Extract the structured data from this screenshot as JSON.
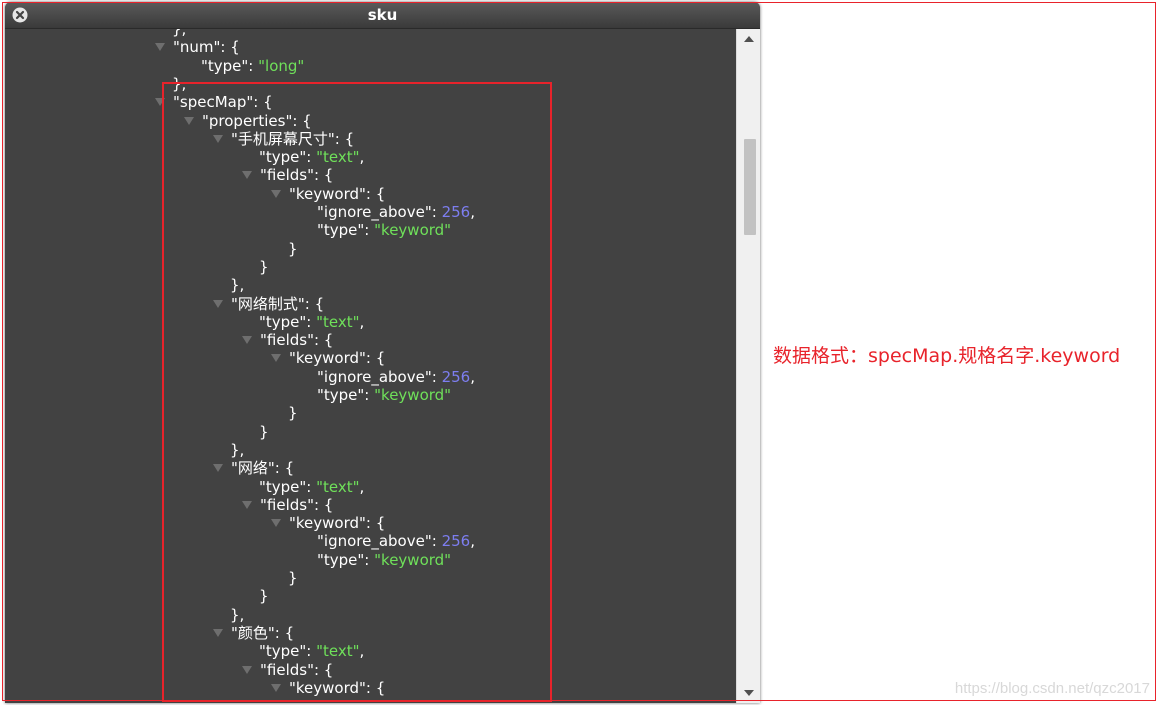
{
  "window": {
    "title": "sku"
  },
  "code_lines": [
    {
      "indent": 8,
      "tri": false,
      "tokens": [
        {
          "t": "},",
          "c": "key"
        }
      ]
    },
    {
      "indent": 8,
      "tri": true,
      "tokens": [
        {
          "t": "\"num\": {",
          "c": "key"
        }
      ]
    },
    {
      "indent": 9,
      "tri": false,
      "tokens": [
        {
          "t": "\"type\": ",
          "c": "key"
        },
        {
          "t": "\"long\"",
          "c": "str"
        }
      ]
    },
    {
      "indent": 8,
      "tri": false,
      "tokens": [
        {
          "t": "},",
          "c": "key"
        }
      ]
    },
    {
      "indent": 8,
      "tri": true,
      "tokens": [
        {
          "t": "\"specMap\": {",
          "c": "key"
        }
      ]
    },
    {
      "indent": 9,
      "tri": true,
      "tokens": [
        {
          "t": "\"properties\": {",
          "c": "key"
        }
      ]
    },
    {
      "indent": 10,
      "tri": true,
      "tokens": [
        {
          "t": "\"手机屏幕尺寸\": {",
          "c": "key"
        }
      ]
    },
    {
      "indent": 11,
      "tri": false,
      "tokens": [
        {
          "t": "\"type\": ",
          "c": "key"
        },
        {
          "t": "\"text\"",
          "c": "str"
        },
        {
          "t": ",",
          "c": "key"
        }
      ]
    },
    {
      "indent": 11,
      "tri": true,
      "tokens": [
        {
          "t": "\"fields\": {",
          "c": "key"
        }
      ]
    },
    {
      "indent": 12,
      "tri": true,
      "tokens": [
        {
          "t": "\"keyword\": {",
          "c": "key"
        }
      ]
    },
    {
      "indent": 13,
      "tri": false,
      "tokens": [
        {
          "t": "\"ignore_above\": ",
          "c": "key"
        },
        {
          "t": "256",
          "c": "num"
        },
        {
          "t": ",",
          "c": "key"
        }
      ]
    },
    {
      "indent": 13,
      "tri": false,
      "tokens": [
        {
          "t": "\"type\": ",
          "c": "key"
        },
        {
          "t": "\"keyword\"",
          "c": "str"
        }
      ]
    },
    {
      "indent": 12,
      "tri": false,
      "tokens": [
        {
          "t": "}",
          "c": "key"
        }
      ]
    },
    {
      "indent": 11,
      "tri": false,
      "tokens": [
        {
          "t": "}",
          "c": "key"
        }
      ]
    },
    {
      "indent": 10,
      "tri": false,
      "tokens": [
        {
          "t": "},",
          "c": "key"
        }
      ]
    },
    {
      "indent": 10,
      "tri": true,
      "tokens": [
        {
          "t": "\"网络制式\": {",
          "c": "key"
        }
      ]
    },
    {
      "indent": 11,
      "tri": false,
      "tokens": [
        {
          "t": "\"type\": ",
          "c": "key"
        },
        {
          "t": "\"text\"",
          "c": "str"
        },
        {
          "t": ",",
          "c": "key"
        }
      ]
    },
    {
      "indent": 11,
      "tri": true,
      "tokens": [
        {
          "t": "\"fields\": {",
          "c": "key"
        }
      ]
    },
    {
      "indent": 12,
      "tri": true,
      "tokens": [
        {
          "t": "\"keyword\": {",
          "c": "key"
        }
      ]
    },
    {
      "indent": 13,
      "tri": false,
      "tokens": [
        {
          "t": "\"ignore_above\": ",
          "c": "key"
        },
        {
          "t": "256",
          "c": "num"
        },
        {
          "t": ",",
          "c": "key"
        }
      ]
    },
    {
      "indent": 13,
      "tri": false,
      "tokens": [
        {
          "t": "\"type\": ",
          "c": "key"
        },
        {
          "t": "\"keyword\"",
          "c": "str"
        }
      ]
    },
    {
      "indent": 12,
      "tri": false,
      "tokens": [
        {
          "t": "}",
          "c": "key"
        }
      ]
    },
    {
      "indent": 11,
      "tri": false,
      "tokens": [
        {
          "t": "}",
          "c": "key"
        }
      ]
    },
    {
      "indent": 10,
      "tri": false,
      "tokens": [
        {
          "t": "},",
          "c": "key"
        }
      ]
    },
    {
      "indent": 10,
      "tri": true,
      "tokens": [
        {
          "t": "\"网络\": {",
          "c": "key"
        }
      ]
    },
    {
      "indent": 11,
      "tri": false,
      "tokens": [
        {
          "t": "\"type\": ",
          "c": "key"
        },
        {
          "t": "\"text\"",
          "c": "str"
        },
        {
          "t": ",",
          "c": "key"
        }
      ]
    },
    {
      "indent": 11,
      "tri": true,
      "tokens": [
        {
          "t": "\"fields\": {",
          "c": "key"
        }
      ]
    },
    {
      "indent": 12,
      "tri": true,
      "tokens": [
        {
          "t": "\"keyword\": {",
          "c": "key"
        }
      ]
    },
    {
      "indent": 13,
      "tri": false,
      "tokens": [
        {
          "t": "\"ignore_above\": ",
          "c": "key"
        },
        {
          "t": "256",
          "c": "num"
        },
        {
          "t": ",",
          "c": "key"
        }
      ]
    },
    {
      "indent": 13,
      "tri": false,
      "tokens": [
        {
          "t": "\"type\": ",
          "c": "key"
        },
        {
          "t": "\"keyword\"",
          "c": "str"
        }
      ]
    },
    {
      "indent": 12,
      "tri": false,
      "tokens": [
        {
          "t": "}",
          "c": "key"
        }
      ]
    },
    {
      "indent": 11,
      "tri": false,
      "tokens": [
        {
          "t": "}",
          "c": "key"
        }
      ]
    },
    {
      "indent": 10,
      "tri": false,
      "tokens": [
        {
          "t": "},",
          "c": "key"
        }
      ]
    },
    {
      "indent": 10,
      "tri": true,
      "tokens": [
        {
          "t": "\"颜色\": {",
          "c": "key"
        }
      ]
    },
    {
      "indent": 11,
      "tri": false,
      "tokens": [
        {
          "t": "\"type\": ",
          "c": "key"
        },
        {
          "t": "\"text\"",
          "c": "str"
        },
        {
          "t": ",",
          "c": "key"
        }
      ]
    },
    {
      "indent": 11,
      "tri": true,
      "tokens": [
        {
          "t": "\"fields\": {",
          "c": "key"
        }
      ]
    },
    {
      "indent": 12,
      "tri": true,
      "tokens": [
        {
          "t": "\"keyword\": {",
          "c": "key"
        }
      ]
    }
  ],
  "annotation": {
    "text": "数据格式：specMap.规格名字.keyword"
  },
  "watermark": {
    "text": "https://blog.csdn.net/qzc2017"
  },
  "colors": {
    "string": "#6fe05a",
    "number": "#7d7ef0",
    "key": "#ffffff",
    "background": "#424242",
    "annotation_red": "#e8232b"
  },
  "icons": {
    "close": "close-icon",
    "collapse": "triangle-down-icon",
    "scroll_up": "arrow-up-icon",
    "scroll_down": "arrow-down-icon"
  }
}
